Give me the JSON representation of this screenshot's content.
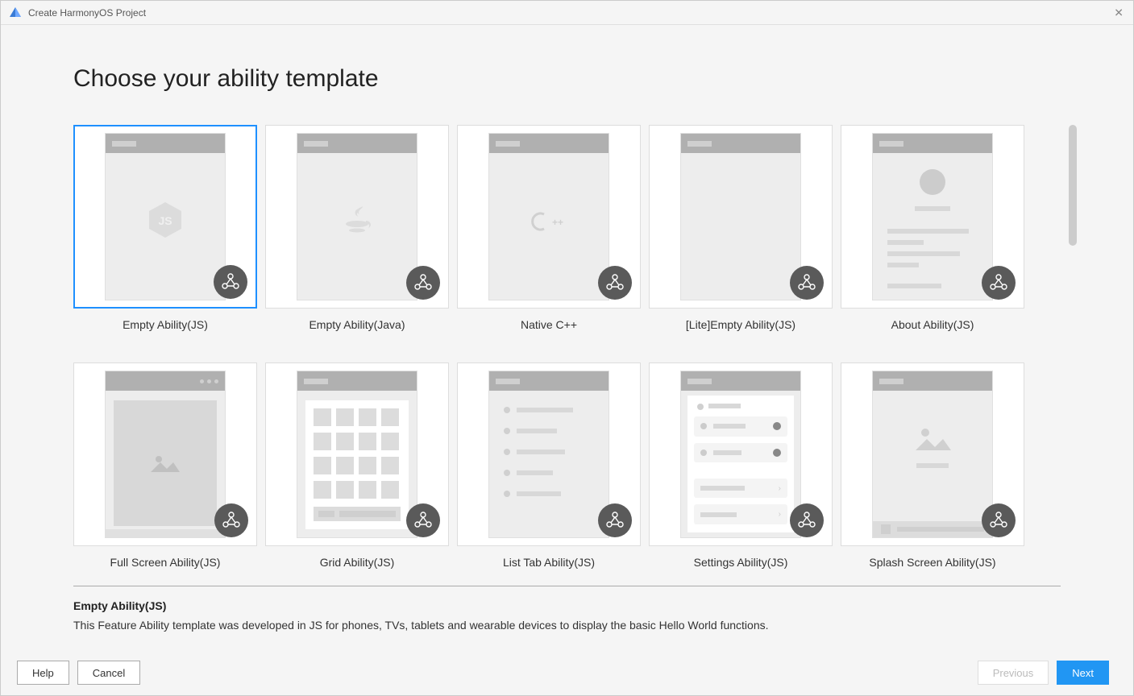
{
  "window": {
    "title": "Create HarmonyOS Project"
  },
  "heading": "Choose your ability template",
  "templates": [
    {
      "id": "empty-js",
      "label": "Empty Ability(JS)",
      "selected": true
    },
    {
      "id": "empty-java",
      "label": "Empty Ability(Java)",
      "selected": false
    },
    {
      "id": "native-cpp",
      "label": "Native C++",
      "selected": false
    },
    {
      "id": "lite-empty-js",
      "label": "[Lite]Empty Ability(JS)",
      "selected": false
    },
    {
      "id": "about-js",
      "label": "About Ability(JS)",
      "selected": false
    },
    {
      "id": "fullscreen-js",
      "label": "Full Screen Ability(JS)",
      "selected": false
    },
    {
      "id": "grid-js",
      "label": "Grid Ability(JS)",
      "selected": false
    },
    {
      "id": "listtab-js",
      "label": "List Tab Ability(JS)",
      "selected": false
    },
    {
      "id": "settings-js",
      "label": "Settings Ability(JS)",
      "selected": false
    },
    {
      "id": "splash-js",
      "label": "Splash Screen Ability(JS)",
      "selected": false
    }
  ],
  "description": {
    "title": "Empty Ability(JS)",
    "text": "This Feature Ability template was developed in JS for phones, TVs, tablets and wearable devices to display the basic Hello World functions."
  },
  "footer": {
    "help": "Help",
    "cancel": "Cancel",
    "previous": "Previous",
    "next": "Next"
  }
}
